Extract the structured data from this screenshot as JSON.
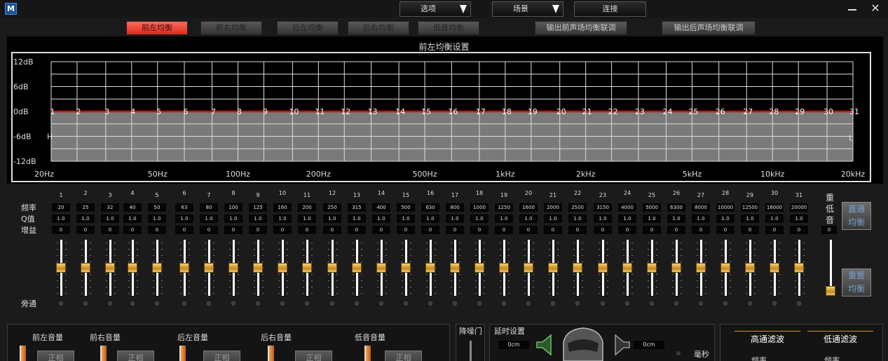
{
  "toolbar": {
    "logo": "M",
    "options_label": "选项",
    "scene_label": "场景",
    "connect_label": "连接",
    "minimize": "minimize",
    "close": "✕"
  },
  "tabs": [
    {
      "label": "前左均衡",
      "active": true
    },
    {
      "label": "前右均衡",
      "active": false
    },
    {
      "label": "后左均衡",
      "active": false
    },
    {
      "label": "后右均衡",
      "active": false
    },
    {
      "label": "低音均衡",
      "active": false
    }
  ],
  "link_buttons": {
    "front": "输出前声场均衡联调",
    "rear": "输出后声场均衡联调"
  },
  "graph": {
    "title": "前左均衡设置",
    "db_labels": [
      "12dB",
      "6dB",
      "0dB",
      "-6dB",
      "-12dB"
    ],
    "freq_labels": [
      "20Hz",
      "50Hz",
      "100Hz",
      "200Hz",
      "500Hz",
      "1kHz",
      "2kHz",
      "5kHz",
      "10kHz",
      "20kHz"
    ],
    "marker_h": "H",
    "marker_l": "L",
    "curve_color": "#d01010"
  },
  "chart_data": {
    "type": "line",
    "title": "前左均衡设置",
    "x": [
      20,
      25,
      32,
      40,
      50,
      63,
      80,
      100,
      125,
      160,
      200,
      250,
      315,
      400,
      500,
      630,
      800,
      1000,
      1250,
      1600,
      2000,
      2500,
      3150,
      4000,
      5000,
      6300,
      8000,
      10000,
      12500,
      16000,
      20000
    ],
    "series": [
      {
        "values": [
          0,
          0,
          0,
          0,
          0,
          0,
          0,
          0,
          0,
          0,
          0,
          0,
          0,
          0,
          0,
          0,
          0,
          0,
          0,
          0,
          0,
          0,
          0,
          0,
          0,
          0,
          0,
          0,
          0,
          0,
          0
        ]
      }
    ],
    "xlim": [
      20,
      20000
    ],
    "ylim": [
      -12,
      12
    ],
    "xscale": "log",
    "grid": true
  },
  "eq": {
    "row_labels": {
      "freq": "频率",
      "q": "Q值",
      "gain": "增益",
      "bypass": "旁通"
    },
    "bands": [
      {
        "no": "1",
        "freq": "20",
        "q": "1.0",
        "gain": "0"
      },
      {
        "no": "2",
        "freq": "25",
        "q": "1.0",
        "gain": "0"
      },
      {
        "no": "3",
        "freq": "32",
        "q": "1.0",
        "gain": "0"
      },
      {
        "no": "4",
        "freq": "40",
        "q": "1.0",
        "gain": "0"
      },
      {
        "no": "5",
        "freq": "50",
        "q": "1.0",
        "gain": "0"
      },
      {
        "no": "6",
        "freq": "63",
        "q": "1.0",
        "gain": "0"
      },
      {
        "no": "7",
        "freq": "80",
        "q": "1.0",
        "gain": "0"
      },
      {
        "no": "8",
        "freq": "100",
        "q": "1.0",
        "gain": "0"
      },
      {
        "no": "9",
        "freq": "125",
        "q": "1.0",
        "gain": "0"
      },
      {
        "no": "10",
        "freq": "160",
        "q": "1.0",
        "gain": "0"
      },
      {
        "no": "11",
        "freq": "200",
        "q": "1.0",
        "gain": "0"
      },
      {
        "no": "12",
        "freq": "250",
        "q": "1.0",
        "gain": "0"
      },
      {
        "no": "13",
        "freq": "315",
        "q": "1.0",
        "gain": "0"
      },
      {
        "no": "14",
        "freq": "400",
        "q": "1.0",
        "gain": "0"
      },
      {
        "no": "15",
        "freq": "500",
        "q": "1.0",
        "gain": "0"
      },
      {
        "no": "16",
        "freq": "630",
        "q": "1.0",
        "gain": "0"
      },
      {
        "no": "17",
        "freq": "800",
        "q": "1.0",
        "gain": "0"
      },
      {
        "no": "18",
        "freq": "1000",
        "q": "1.0",
        "gain": "0"
      },
      {
        "no": "19",
        "freq": "1250",
        "q": "1.0",
        "gain": "0"
      },
      {
        "no": "20",
        "freq": "1600",
        "q": "1.0",
        "gain": "0"
      },
      {
        "no": "21",
        "freq": "2000",
        "q": "1.0",
        "gain": "0"
      },
      {
        "no": "22",
        "freq": "2500",
        "q": "1.0",
        "gain": "0"
      },
      {
        "no": "23",
        "freq": "3150",
        "q": "1.0",
        "gain": "0"
      },
      {
        "no": "24",
        "freq": "4000",
        "q": "1.0",
        "gain": "0"
      },
      {
        "no": "25",
        "freq": "5000",
        "q": "1.0",
        "gain": "0"
      },
      {
        "no": "26",
        "freq": "6300",
        "q": "1.0",
        "gain": "0"
      },
      {
        "no": "27",
        "freq": "8000",
        "q": "1.0",
        "gain": "0"
      },
      {
        "no": "28",
        "freq": "10000",
        "q": "1.0",
        "gain": "0"
      },
      {
        "no": "29",
        "freq": "12500",
        "q": "1.0",
        "gain": "0"
      },
      {
        "no": "30",
        "freq": "16000",
        "q": "1.0",
        "gain": "0"
      },
      {
        "no": "31",
        "freq": "20000",
        "q": "1.0",
        "gain": "0"
      }
    ],
    "bass": {
      "label_chars": [
        "重",
        "低",
        "音"
      ],
      "value": "0",
      "level": 0
    },
    "flat_button": [
      "直通",
      "均衡"
    ],
    "reset_button": [
      "重置",
      "均衡"
    ]
  },
  "volume": {
    "channels": [
      {
        "label": "前左音量",
        "button": "正相"
      },
      {
        "label": "前右音量",
        "button": "正相"
      },
      {
        "label": "后左音量",
        "button": "正相"
      },
      {
        "label": "后右音量",
        "button": "正相"
      },
      {
        "label": "低音音量",
        "button": "正相"
      }
    ]
  },
  "noise_gate": {
    "label": "降噪门"
  },
  "delay": {
    "label": "延时设置",
    "left_value": "0cm",
    "right_value": "0cm",
    "unit": "毫秒"
  },
  "filters": {
    "highpass": "高通滤波",
    "lowpass": "低通滤波",
    "sub_left": "频率",
    "sub_right": "频率"
  }
}
